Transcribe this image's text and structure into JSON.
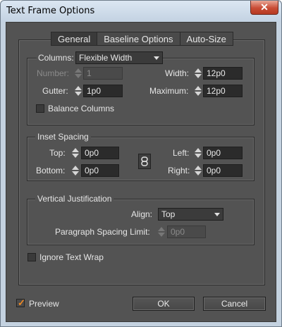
{
  "window": {
    "title": "Text Frame Options",
    "close_glyph": "✕"
  },
  "tabs": [
    {
      "label": "General",
      "active": true
    },
    {
      "label": "Baseline Options",
      "active": false
    },
    {
      "label": "Auto-Size",
      "active": false
    }
  ],
  "columns": {
    "label": "Columns:",
    "type_value": "Flexible Width",
    "number_label": "Number:",
    "number_value": "1",
    "gutter_label": "Gutter:",
    "gutter_value": "1p0",
    "width_label": "Width:",
    "width_value": "12p0",
    "maximum_label": "Maximum:",
    "maximum_value": "12p0",
    "balance_label": "Balance Columns",
    "balance_checked": false
  },
  "inset_spacing": {
    "legend": "Inset Spacing",
    "top_label": "Top:",
    "top_value": "0p0",
    "bottom_label": "Bottom:",
    "bottom_value": "0p0",
    "left_label": "Left:",
    "left_value": "0p0",
    "right_label": "Right:",
    "right_value": "0p0"
  },
  "vertical_justification": {
    "legend": "Vertical Justification",
    "align_label": "Align:",
    "align_value": "Top",
    "spacing_limit_label": "Paragraph Spacing Limit:",
    "spacing_limit_value": "0p0"
  },
  "ignore_text_wrap": {
    "label": "Ignore Text Wrap",
    "checked": false
  },
  "footer": {
    "preview_label": "Preview",
    "preview_checked": true,
    "ok_label": "OK",
    "cancel_label": "Cancel"
  },
  "colors": {
    "dialog_background": "#535353",
    "field_background": "#2b2b2b",
    "accent_check": "#f08a24",
    "titlebar": "#c4d2e0"
  }
}
